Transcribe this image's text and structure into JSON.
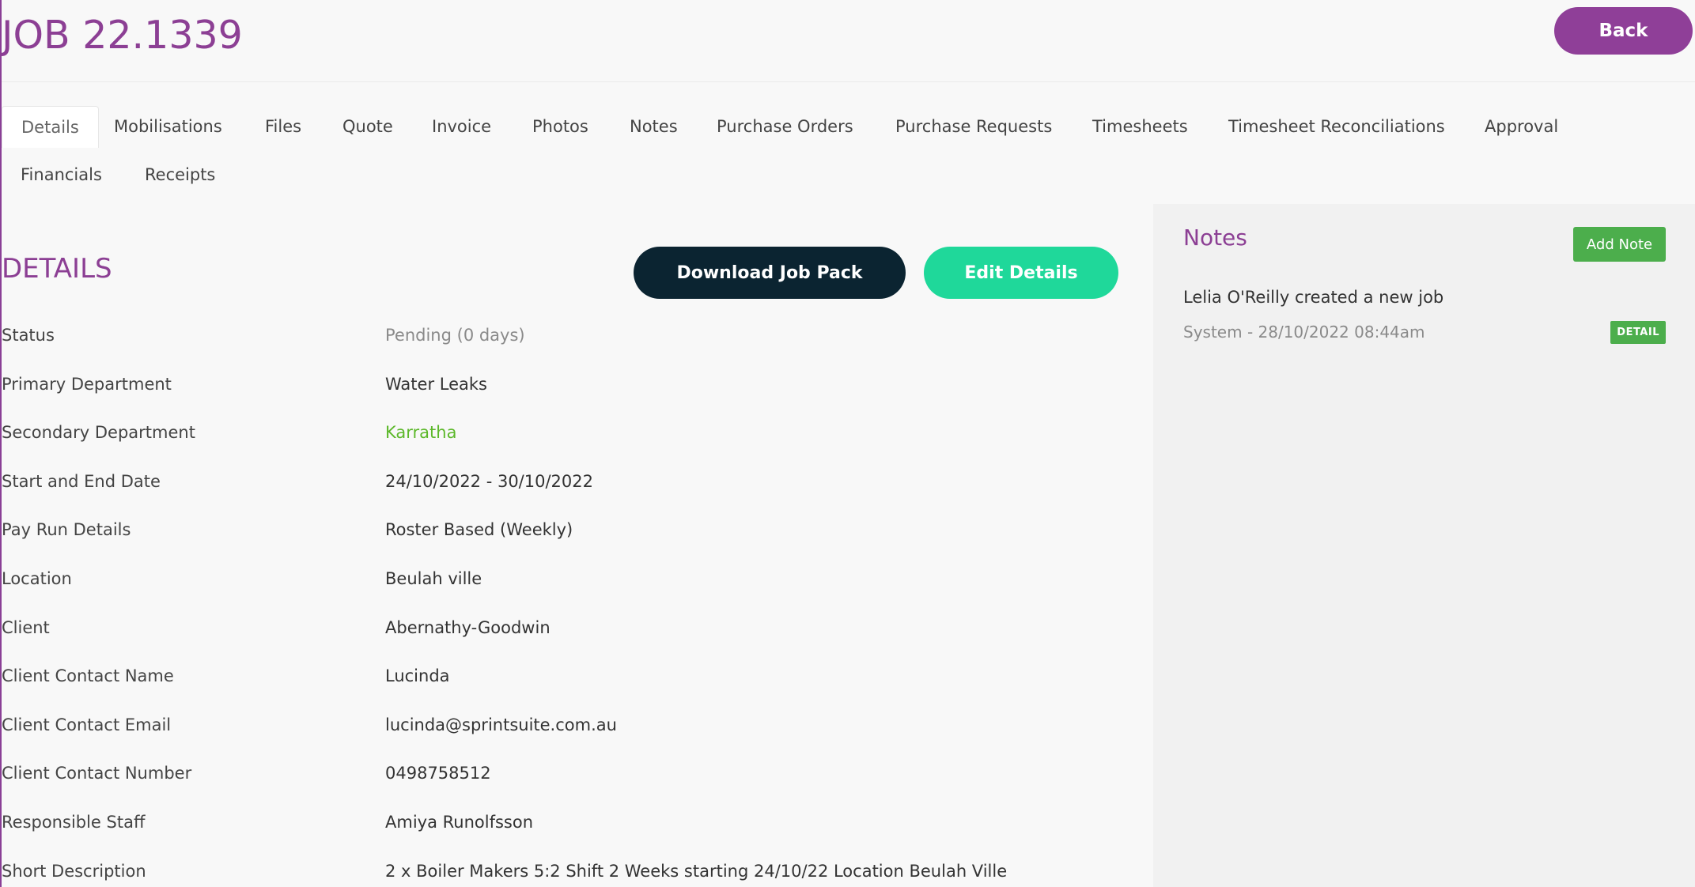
{
  "header": {
    "title": "JOB 22.1339",
    "back_label": "Back"
  },
  "tabs": [
    {
      "label": "Details",
      "active": true
    },
    {
      "label": "Mobilisations"
    },
    {
      "label": "Files"
    },
    {
      "label": "Quote"
    },
    {
      "label": "Invoice"
    },
    {
      "label": "Photos"
    },
    {
      "label": "Notes"
    },
    {
      "label": "Purchase Orders"
    },
    {
      "label": "Purchase Requests"
    },
    {
      "label": "Timesheets"
    },
    {
      "label": "Timesheet Reconciliations"
    },
    {
      "label": "Approval"
    },
    {
      "label": "Financials"
    },
    {
      "label": "Receipts"
    }
  ],
  "details": {
    "title": "DETAILS",
    "download_label": "Download Job Pack",
    "edit_label": "Edit Details",
    "fields": [
      {
        "label": "Status",
        "value": "Pending (0 days)"
      },
      {
        "label": "Primary Department",
        "value": "Water Leaks"
      },
      {
        "label": "Secondary Department",
        "value": "Karratha"
      },
      {
        "label": "Start and End Date",
        "value": "24/10/2022 - 30/10/2022"
      },
      {
        "label": "Pay Run Details",
        "value": "Roster Based (Weekly)"
      },
      {
        "label": "Location",
        "value": "Beulah ville"
      },
      {
        "label": "Client",
        "value": "Abernathy-Goodwin"
      },
      {
        "label": "Client Contact Name",
        "value": "Lucinda"
      },
      {
        "label": "Client Contact Email",
        "value": "lucinda@sprintsuite.com.au"
      },
      {
        "label": "Client Contact Number",
        "value": "0498758512"
      },
      {
        "label": "Responsible Staff",
        "value": "Amiya Runolfsson"
      },
      {
        "label": "Short Description",
        "value": "2 x Boiler Makers 5:2 Shift 2 Weeks starting 24/10/22 Location Beulah Ville"
      }
    ]
  },
  "notes": {
    "title": "Notes",
    "add_label": "Add Note",
    "items": [
      {
        "text": "Lelia O'Reilly created a new job",
        "meta": "System - 28/10/2022 08:44am",
        "badge": "DETAIL"
      }
    ]
  },
  "colors": {
    "brand_purple": "#8c3f94",
    "dark_button": "#0b2431",
    "teal_button": "#1fd89a",
    "green": "#4cae4c",
    "link_green": "#5cb82a"
  }
}
